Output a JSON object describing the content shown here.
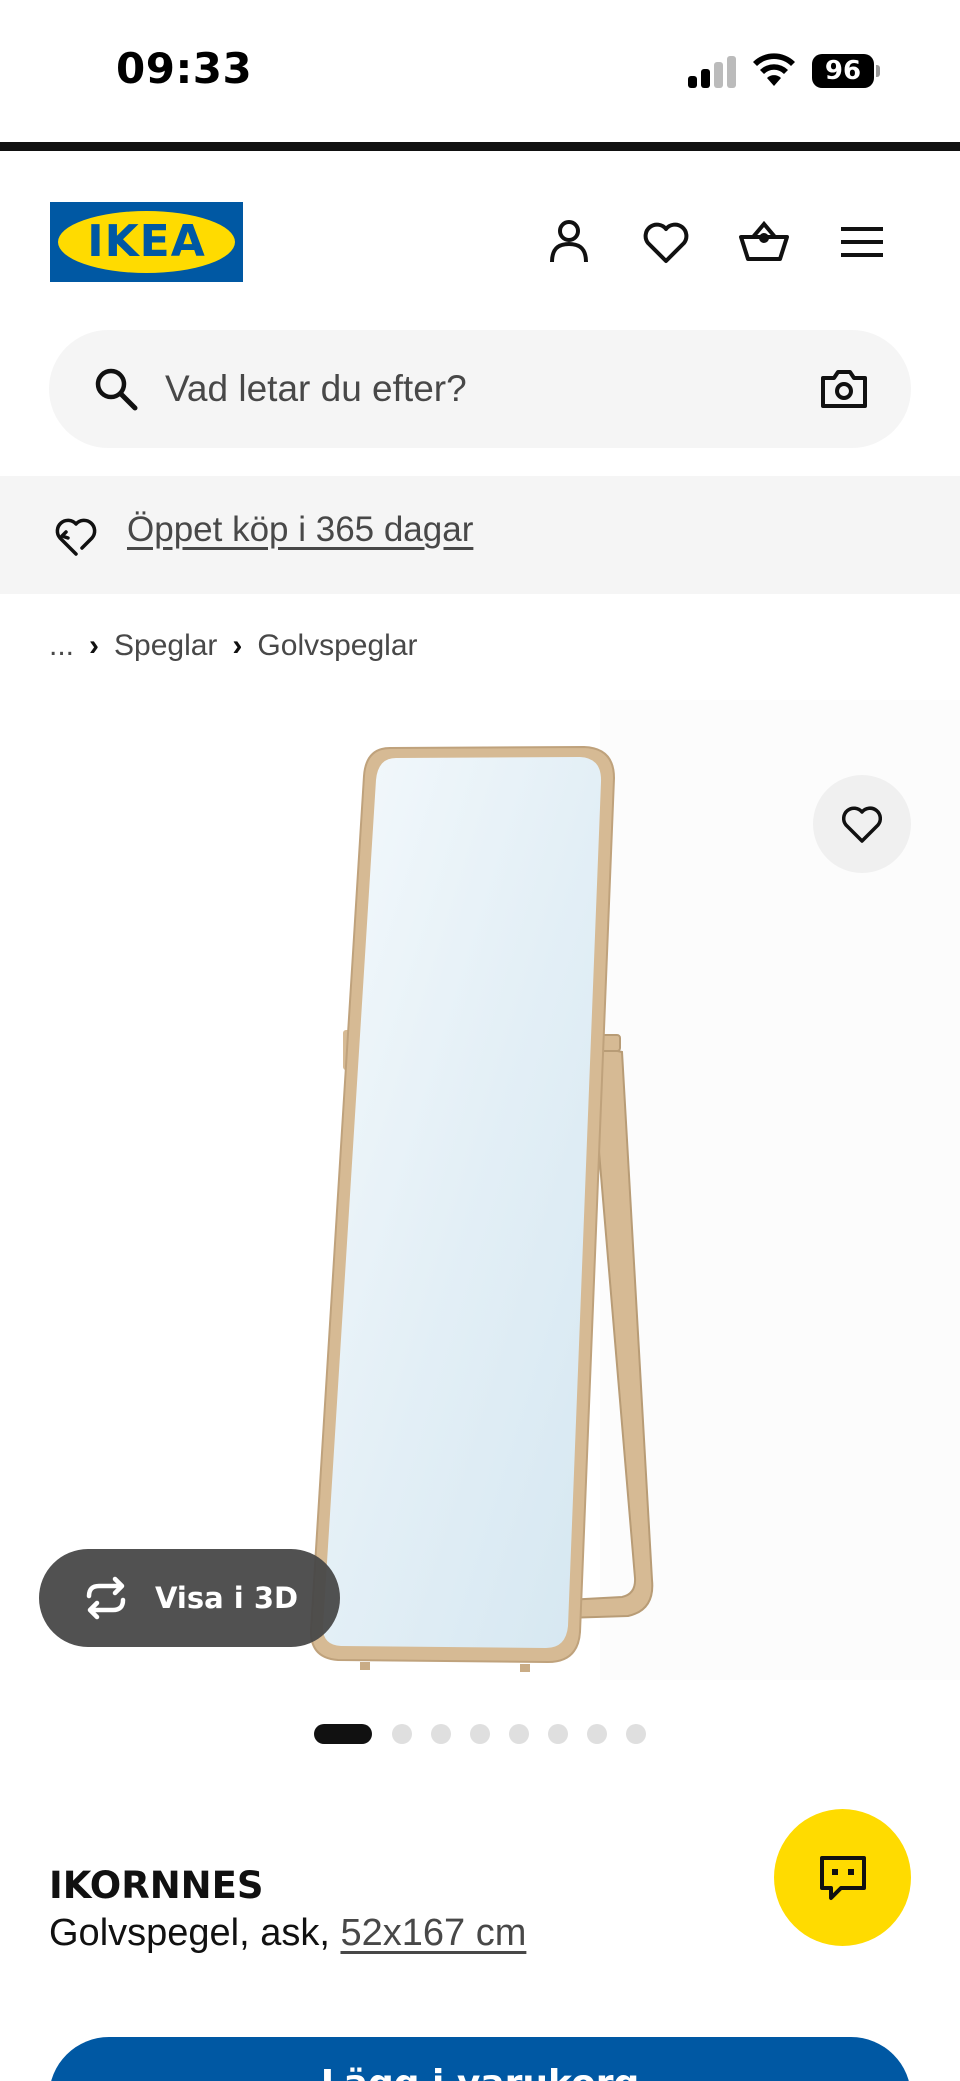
{
  "status_bar": {
    "time": "09:33",
    "battery": "96",
    "signal_icon": "cellular-signal-icon",
    "wifi_icon": "wifi-icon"
  },
  "header": {
    "logo_text": "IKEA",
    "icons": [
      "user-icon",
      "heart-icon",
      "basket-icon",
      "menu-icon"
    ]
  },
  "search": {
    "placeholder": "Vad letar du efter?",
    "icon": "search-icon",
    "camera_icon": "camera-icon"
  },
  "banner": {
    "link": "Öppet köp i 365 dagar",
    "icon": "return-heart-icon"
  },
  "breadcrumb": {
    "items": [
      "...",
      "Speglar",
      "Golvspeglar"
    ]
  },
  "gallery": {
    "view_3d_label": "Visa i 3D",
    "image_count": 8,
    "active_index": 0,
    "colors": {
      "frame": "#d6ba94",
      "glass": "#dcebf3"
    }
  },
  "product": {
    "name": "IKORNNES",
    "description": "Golvspegel, ask, ",
    "size": "52x167 cm",
    "cta_label": "Lägg i varukorg"
  },
  "colors": {
    "ikea_blue": "#0058a3",
    "ikea_yellow": "#ffdb00"
  }
}
